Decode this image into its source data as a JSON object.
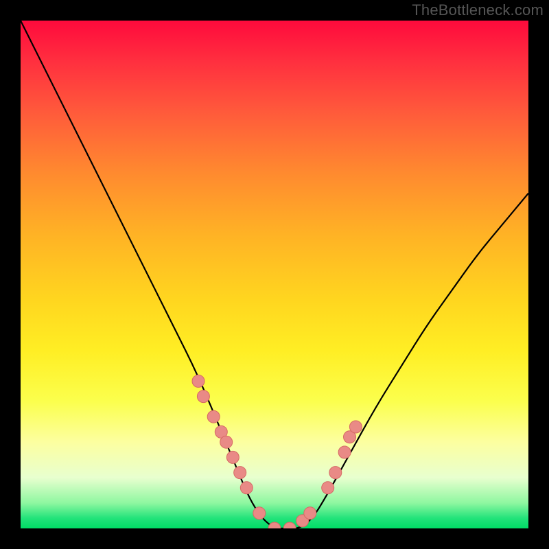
{
  "watermark": "TheBottleneck.com",
  "chart_data": {
    "type": "line",
    "title": "",
    "xlabel": "",
    "ylabel": "",
    "xlim": [
      0,
      1
    ],
    "ylim": [
      0,
      1
    ],
    "series": [
      {
        "name": "curve",
        "x": [
          0.0,
          0.05,
          0.1,
          0.15,
          0.2,
          0.25,
          0.3,
          0.35,
          0.4,
          0.425,
          0.45,
          0.475,
          0.5,
          0.525,
          0.55,
          0.575,
          0.6,
          0.65,
          0.7,
          0.75,
          0.8,
          0.85,
          0.9,
          0.95,
          1.0
        ],
        "y": [
          1.0,
          0.9,
          0.8,
          0.7,
          0.6,
          0.5,
          0.4,
          0.3,
          0.18,
          0.12,
          0.06,
          0.02,
          0.0,
          0.0,
          0.0,
          0.02,
          0.06,
          0.15,
          0.24,
          0.32,
          0.4,
          0.47,
          0.54,
          0.6,
          0.66
        ]
      }
    ],
    "markers": {
      "name": "highlight-points",
      "x": [
        0.35,
        0.36,
        0.38,
        0.395,
        0.405,
        0.418,
        0.432,
        0.445,
        0.47,
        0.5,
        0.53,
        0.555,
        0.57,
        0.605,
        0.62,
        0.638,
        0.648,
        0.66
      ],
      "y": [
        0.29,
        0.26,
        0.22,
        0.19,
        0.17,
        0.14,
        0.11,
        0.08,
        0.03,
        0.0,
        0.0,
        0.015,
        0.03,
        0.08,
        0.11,
        0.15,
        0.18,
        0.2
      ]
    },
    "colors": {
      "curve": "#000000",
      "marker_fill": "#e98a86",
      "marker_stroke": "#d66964"
    }
  }
}
